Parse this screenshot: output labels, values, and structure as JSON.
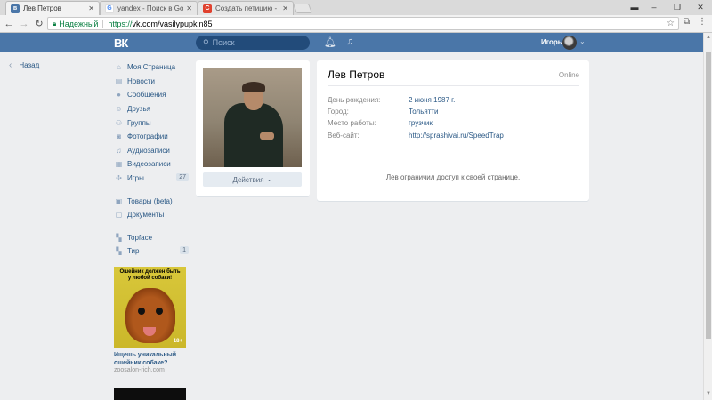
{
  "browser": {
    "tabs": [
      {
        "title": "Лев Петров",
        "favicon": "vk-icon",
        "active": true
      },
      {
        "title": "yandex - Поиск в Google",
        "favicon": "google-icon",
        "active": false
      },
      {
        "title": "Создать петицию - Chan",
        "favicon": "change-org-icon",
        "active": false
      }
    ],
    "security_label": "Надежный",
    "url_scheme": "https://",
    "url_rest": "vk.com/vasilypupkin85"
  },
  "vk_header": {
    "logo": "ВК",
    "search_placeholder": "Поиск",
    "user_name": "Игорь"
  },
  "sidebar": {
    "back_label": "Назад",
    "items": [
      {
        "label": "Моя Страница",
        "icon": "home-icon"
      },
      {
        "label": "Новости",
        "icon": "news-icon"
      },
      {
        "label": "Сообщения",
        "icon": "messages-icon"
      },
      {
        "label": "Друзья",
        "icon": "friends-icon"
      },
      {
        "label": "Группы",
        "icon": "groups-icon"
      },
      {
        "label": "Фотографии",
        "icon": "camera-icon"
      },
      {
        "label": "Аудиозаписи",
        "icon": "music-icon"
      },
      {
        "label": "Видеозаписи",
        "icon": "video-icon"
      },
      {
        "label": "Игры",
        "icon": "games-icon",
        "badge": "27"
      },
      {
        "label": "Товары (beta)",
        "icon": "goods-icon"
      },
      {
        "label": "Документы",
        "icon": "documents-icon"
      },
      {
        "label": "Topface",
        "icon": "app-icon"
      },
      {
        "label": "Тир",
        "icon": "app-icon",
        "badge": "1"
      }
    ]
  },
  "ad": {
    "image_text": "Ошейник должен быть у любой собаки!",
    "age_label": "18+",
    "caption": "Ищешь уникальный ошейник собаке?",
    "domain": "zoosalon-rich.com"
  },
  "profile": {
    "actions_label": "Действия",
    "name": "Лев Петров",
    "status": "Online",
    "fields": [
      {
        "label": "День рождения:",
        "value": "2 июня 1987 г."
      },
      {
        "label": "Город:",
        "value": "Тольятти"
      },
      {
        "label": "Место работы:",
        "value": "грузчик"
      },
      {
        "label": "Веб-сайт:",
        "value": "http://sprashivai.ru/SpeedTrap"
      }
    ],
    "restricted_text": "Лев ограничил доступ к своей странице."
  },
  "colors": {
    "vk_header": "#4a76a8",
    "link": "#2a5885",
    "page_bg": "#edeef0"
  }
}
